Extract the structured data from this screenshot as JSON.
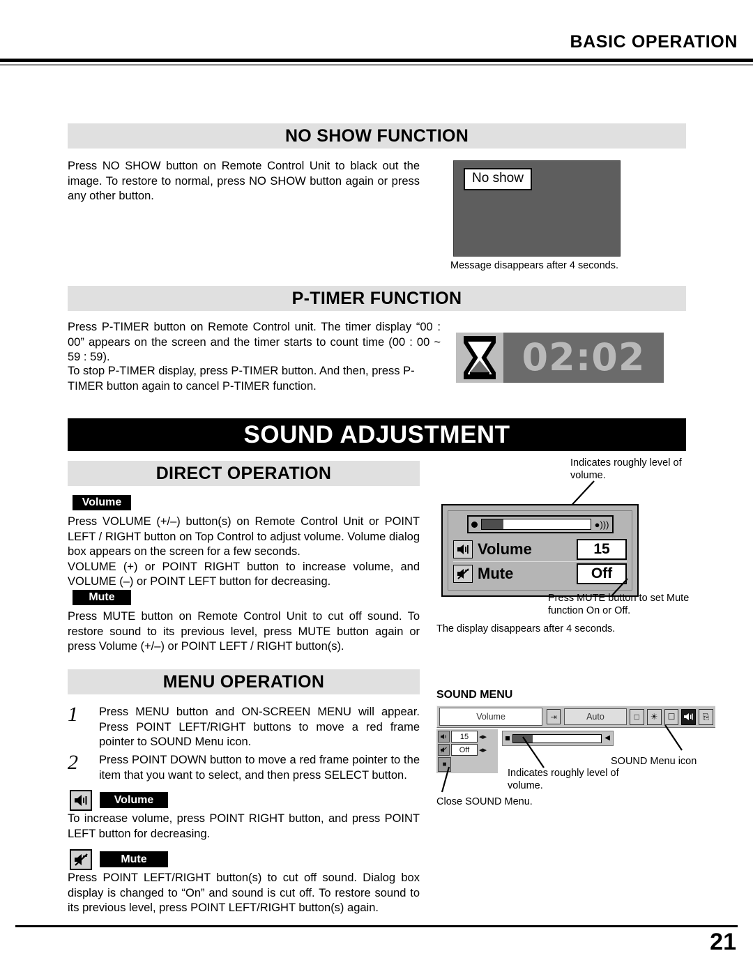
{
  "header": {
    "title": "BASIC OPERATION"
  },
  "footer": {
    "page_number": "21"
  },
  "sections": {
    "no_show": {
      "band_title": "NO SHOW FUNCTION",
      "body": "Press NO SHOW button on Remote Control Unit to black out the image.  To restore to normal, press NO SHOW button again or press any other button.",
      "screen_message": "No show",
      "caption": "Message disappears after 4 seconds."
    },
    "p_timer": {
      "band_title": "P-TIMER FUNCTION",
      "body_1": "Press P-TIMER button on Remote Control unit.  The timer display “00 : 00” appears on the screen and the timer starts to count time (00 : 00 ~ 59 : 59).",
      "body_2": "To stop P-TIMER display, press P-TIMER button.  And then, press P-TIMER button again to cancel P-TIMER function.",
      "timer_value": "02:02",
      "timer_icon": "hourglass-icon"
    },
    "sound_adjustment": {
      "banner_title": "SOUND ADJUSTMENT"
    },
    "direct_operation": {
      "band_title": "DIRECT OPERATION",
      "volume_chip": "Volume",
      "volume_body": "Press VOLUME (+/–) button(s) on Remote Control Unit or POINT LEFT / RIGHT button on Top Control to adjust volume.  Volume dialog box appears on the screen for a few seconds.\nVOLUME (+) or POINT RIGHT button to increase volume, and VOLUME (–) or POINT LEFT button for decreasing.",
      "mute_chip": "Mute",
      "mute_body": "Press MUTE button on Remote Control Unit to cut off sound.  To restore sound to its previous level, press MUTE button again or press Volume (+/–) or POINT LEFT / RIGHT button(s)."
    },
    "volume_dialog": {
      "annotation_top": "Indicates roughly level of volume.",
      "annotation_mute": "Press MUTE button to set Mute function On or Off.",
      "caption": "The display disappears after 4 seconds.",
      "rows": [
        {
          "icon": "speaker-icon",
          "label": "Volume",
          "value": "15"
        },
        {
          "icon": "mute-icon",
          "label": "Mute",
          "value": "Off"
        }
      ],
      "slider_percent": 20
    },
    "menu_operation": {
      "band_title": "MENU OPERATION",
      "steps": [
        {
          "number": "1",
          "text": "Press MENU button and ON-SCREEN MENU will appear.  Press POINT LEFT/RIGHT buttons to move a red frame pointer to SOUND Menu icon."
        },
        {
          "number": "2",
          "text": "Press POINT DOWN button to move a red frame pointer to the item that you want to select, and then press SELECT button."
        }
      ],
      "volume_chip": "Volume",
      "volume_icon": "speaker-icon",
      "volume_body": "To increase volume, press POINT RIGHT button, and press POINT LEFT button for decreasing.",
      "mute_chip": "Mute",
      "mute_icon": "mute-icon",
      "mute_body": "Press POINT LEFT/RIGHT button(s) to cut off sound.  Dialog box display is changed to “On” and sound is cut off.  To restore sound to its previous level, press POINT LEFT/RIGHT button(s) again."
    },
    "sound_menu": {
      "title": "SOUND MENU",
      "menu_title": "Volume",
      "auto_label": "Auto",
      "toolbar_icons": [
        "input-icon",
        "square-icon",
        "palette-icon",
        "screen-icon",
        "sound-icon",
        "window-icon"
      ],
      "rows": [
        {
          "icon": "speaker-icon",
          "value": "15"
        },
        {
          "icon": "mute-icon",
          "value": "Off"
        }
      ],
      "quit_icon": "quit-icon",
      "slider_percent": 22,
      "annotation_icon": "SOUND Menu icon",
      "annotation_level": "Indicates roughly level of volume.",
      "annotation_close": "Close SOUND Menu."
    }
  }
}
